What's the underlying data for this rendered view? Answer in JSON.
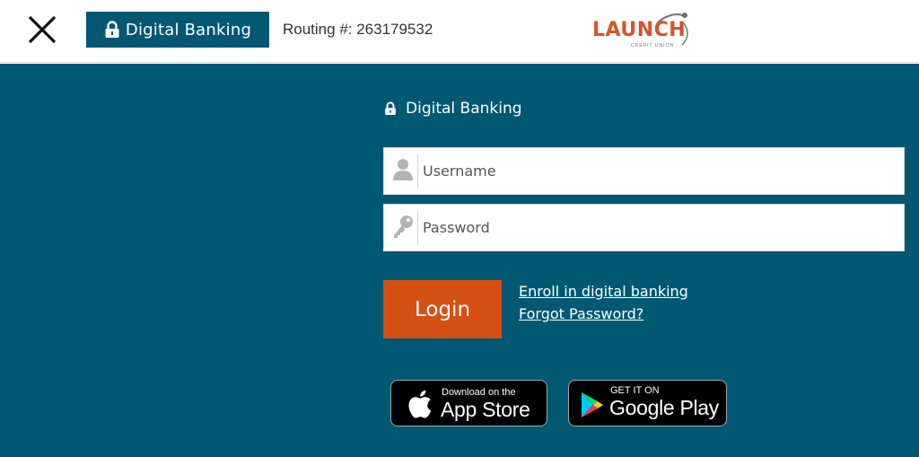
{
  "header": {
    "close_icon": "close-icon",
    "digital_banking_button": {
      "icon": "lock-icon",
      "label": "Digital Banking"
    },
    "routing": "Routing #: 263179532",
    "logo": {
      "name": "LAUNCH",
      "sub": "CREDIT UNION"
    }
  },
  "login_form": {
    "title": "Digital Banking",
    "title_icon": "lock-icon",
    "username": {
      "icon": "user-icon",
      "placeholder": "Username",
      "value": ""
    },
    "password": {
      "icon": "key-icon",
      "placeholder": "Password",
      "value": ""
    },
    "login_label": "Login",
    "enroll_link": "Enroll in digital banking",
    "forgot_link": "Forgot Password?"
  },
  "app_badges": {
    "apple": {
      "small": "Download on the",
      "big": "App Store",
      "icon": "apple-icon"
    },
    "google": {
      "small": "GET IT ON",
      "big": "Google Play",
      "icon": "google-play-icon"
    }
  },
  "colors": {
    "primary": "#005873",
    "accent": "#d64f12",
    "logo": "#d6532a"
  }
}
